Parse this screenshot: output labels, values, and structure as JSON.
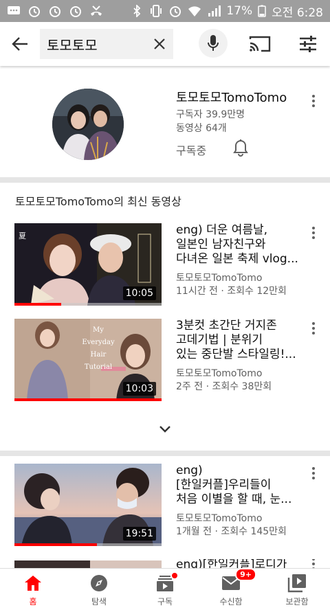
{
  "status_bar": {
    "battery": "17%",
    "time": "오전 6:28"
  },
  "search": {
    "query": "토모토모"
  },
  "channel": {
    "name": "토모토모TomoTomo",
    "subscribers": "구독자 39.9만명",
    "videos": "동영상 64개",
    "subscribed_label": "구독중"
  },
  "section": {
    "title": "토모토모TomoTomo의 최신 동영상"
  },
  "videos": [
    {
      "title_lines": [
        "eng) 더운 여름날,",
        "일본인 남자친구와",
        "다녀온 일본 축제 vlog..."
      ],
      "channel": "토모토모TomoTomo",
      "meta": "11시간 전 · 조회수 12만회",
      "duration": "10:05",
      "progress": 0.32
    },
    {
      "title_lines": [
        "3분컷 초간단 거지존",
        "고데기법 | 분위기",
        "있는 중단발 스타일링!..."
      ],
      "channel": "토모토모TomoTomo",
      "meta": "2주 전 · 조회수 38만회",
      "duration": "10:03",
      "progress": 1.0,
      "thumb_text": [
        "My Everyday",
        "Hair",
        "Tutorial"
      ]
    },
    {
      "title_lines": [
        "eng)",
        "[한일커플]우리들이",
        "처음 이별을 할 때, 눈..."
      ],
      "channel": "토모토모TomoTomo",
      "meta": "1개월 전 · 조회수 145만회",
      "duration": "19:51",
      "progress": 0.56
    },
    {
      "title_lines": [
        "eng)[한일커플]로디가"
      ]
    }
  ],
  "nav": [
    {
      "label": "홈",
      "icon": "home-icon",
      "active": true
    },
    {
      "label": "탐색",
      "icon": "explore-icon"
    },
    {
      "label": "구독",
      "icon": "subscriptions-icon",
      "dot": true
    },
    {
      "label": "수신함",
      "icon": "inbox-icon",
      "badge": "9+"
    },
    {
      "label": "보관함",
      "icon": "library-icon"
    }
  ],
  "colors": {
    "accent": "#ff0000",
    "secondary_text": "#606060",
    "status_bar": "#9e9e9e"
  }
}
